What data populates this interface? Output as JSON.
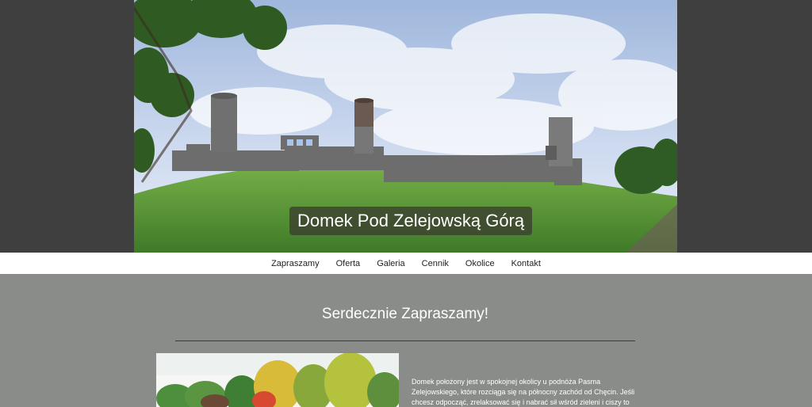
{
  "site": {
    "title": "Domek Pod Zelejowską Górą"
  },
  "nav": {
    "items": [
      {
        "label": "Zapraszamy"
      },
      {
        "label": "Oferta"
      },
      {
        "label": "Galeria"
      },
      {
        "label": "Cennik"
      },
      {
        "label": "Okolice"
      },
      {
        "label": "Kontakt"
      }
    ]
  },
  "main": {
    "heading": "Serdecznie Zapraszamy!",
    "intro": "Domek położony jest w spokojnej okolicy u podnóża Pasma Zelejowskiego, które rozciąga się na północny zachód od Chęcin. Jeśli chcesz odpocząć, zrelaksować się i nabrać sił wśród zieleni i ciszy to"
  },
  "colors": {
    "hero_band": "#3f3f3f",
    "nav_background": "#ffffff",
    "main_background": "#8a8c89",
    "text_light": "#ffffff"
  }
}
